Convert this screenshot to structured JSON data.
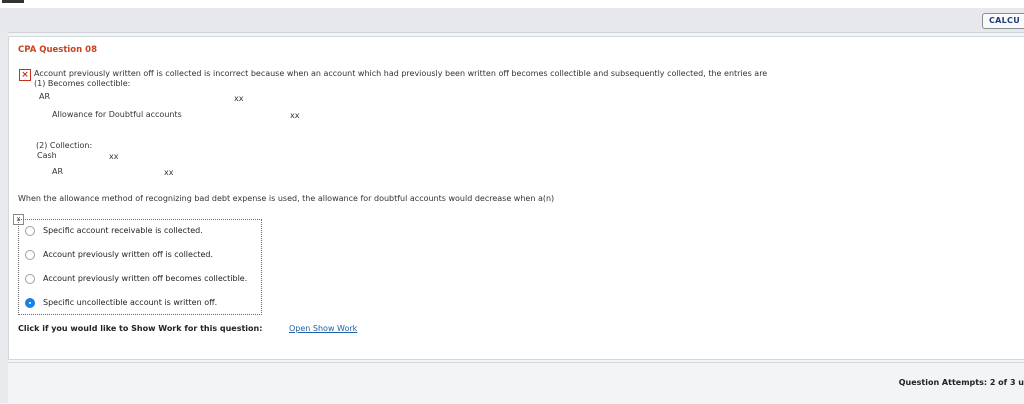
{
  "toolbar": {
    "calc_label": "CALCU"
  },
  "question": {
    "title": "CPA Question 08",
    "feedback_line1": "Account previously written off is collected is incorrect because when an account which had previously been written off becomes collectible and subsequently collected, the entries are",
    "feedback_line2": "(1) Becomes collectible:",
    "entry1": {
      "debit": "AR",
      "debit_amount": "xx",
      "credit": "Allowance for Doubtful accounts",
      "credit_amount": "xx"
    },
    "feedback_line3": "(2) Collection:",
    "entry2": {
      "debit": "Cash",
      "debit_amount": "xx",
      "credit": "AR",
      "credit_amount": "xx"
    },
    "prompt": "When the allowance method of recognizing bad debt expense is used, the allowance for doubtful accounts would decrease when a(n)",
    "options": [
      {
        "label": "Specific account receivable is collected.",
        "selected": false
      },
      {
        "label": "Account previously written off is collected.",
        "selected": false
      },
      {
        "label": "Account previously written off becomes collectible.",
        "selected": false
      },
      {
        "label": "Specific uncollectible account is written off.",
        "selected": true
      }
    ]
  },
  "show_work": {
    "label": "Click if you would like to Show Work for this question:",
    "link": "Open Show Work"
  },
  "footer": {
    "attempts": "Question Attempts: 2 of 3 u"
  },
  "colors": {
    "title": "#c8431e",
    "link": "#1f5fa8",
    "radio_selected": "#1a7fe0",
    "error": "#c3331c"
  }
}
